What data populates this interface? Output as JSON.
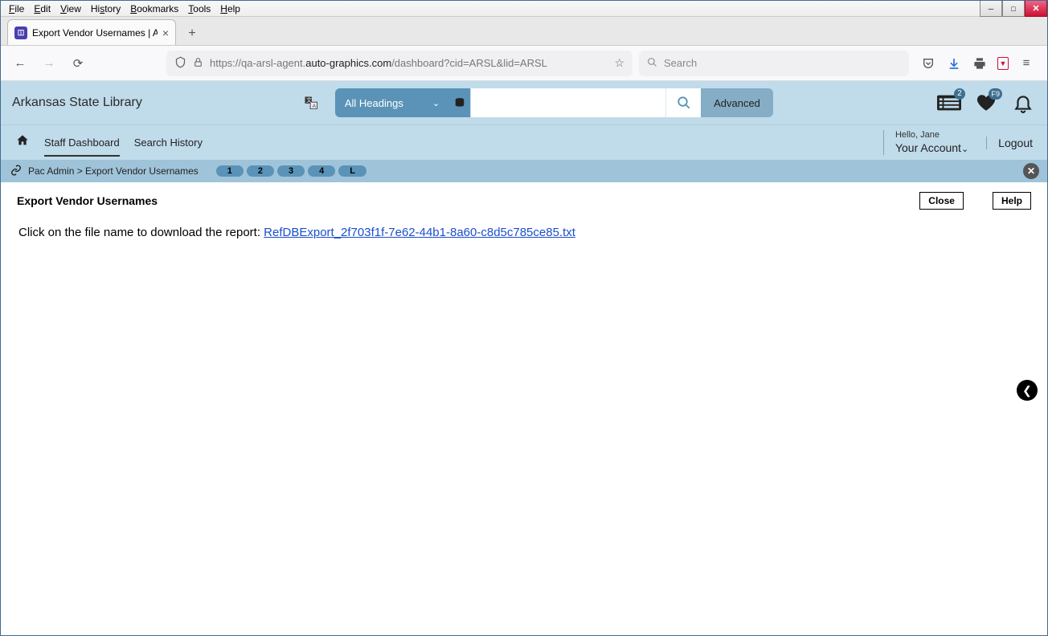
{
  "browser_menu": {
    "file": "File",
    "edit": "Edit",
    "view": "View",
    "history": "History",
    "bookmarks": "Bookmarks",
    "tools": "Tools",
    "help": "Help"
  },
  "tab": {
    "title": "Export Vendor Usernames | ARSL"
  },
  "url": {
    "prefix": "https://qa-arsl-agent.",
    "domain": "auto-graphics.com",
    "path": "/dashboard?cid=ARSL&lid=ARSL"
  },
  "browser_search": {
    "placeholder": "Search"
  },
  "app": {
    "brand": "Arkansas State Library",
    "filter": "All Headings",
    "advanced": "Advanced",
    "list_badge": "2",
    "heart_badge": "F9"
  },
  "nav": {
    "staff": "Staff Dashboard",
    "history": "Search History",
    "hello": "Hello, Jane",
    "account": "Your Account",
    "logout": "Logout"
  },
  "breadcrumb": {
    "text": "Pac Admin  >  Export Vendor Usernames",
    "pills": [
      "1",
      "2",
      "3",
      "4",
      "L"
    ]
  },
  "page": {
    "title": "Export Vendor Usernames",
    "close": "Close",
    "help": "Help",
    "prompt": "Click on the file name to download the report: ",
    "filename": "RefDBExport_2f703f1f-7e62-44b1-8a60-c8d5c785ce85.txt"
  }
}
